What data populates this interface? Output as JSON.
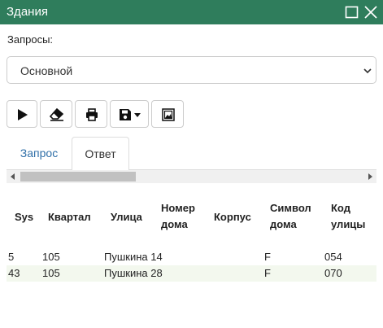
{
  "window": {
    "title": "Здания",
    "accent_color": "#2f7d5c",
    "icons": [
      "maximize-icon",
      "close-icon"
    ]
  },
  "queries": {
    "label": "Запросы:",
    "selected": "Основной"
  },
  "toolbar": {
    "buttons": [
      {
        "name": "run",
        "icon": "play-icon"
      },
      {
        "name": "clear",
        "icon": "eraser-icon"
      },
      {
        "name": "print",
        "icon": "print-icon"
      },
      {
        "name": "save",
        "icon": "save-icon",
        "has_dropdown": true
      },
      {
        "name": "image",
        "icon": "image-icon"
      }
    ]
  },
  "tabs": [
    {
      "label": "Запрос",
      "active": false
    },
    {
      "label": "Ответ",
      "active": true
    }
  ],
  "table": {
    "columns": [
      [
        "Sys"
      ],
      [
        "Квартал"
      ],
      [
        "Улица"
      ],
      [
        "Номер",
        "дома"
      ],
      [
        "Корпус"
      ],
      [
        "Символ",
        "дома"
      ],
      [
        "Код",
        "улицы"
      ]
    ],
    "rows": [
      [
        "5",
        "105",
        "Пушкина 14",
        "",
        "F",
        "054"
      ],
      [
        "43",
        "105",
        "Пушкина 28",
        "",
        "F",
        "070"
      ]
    ]
  }
}
